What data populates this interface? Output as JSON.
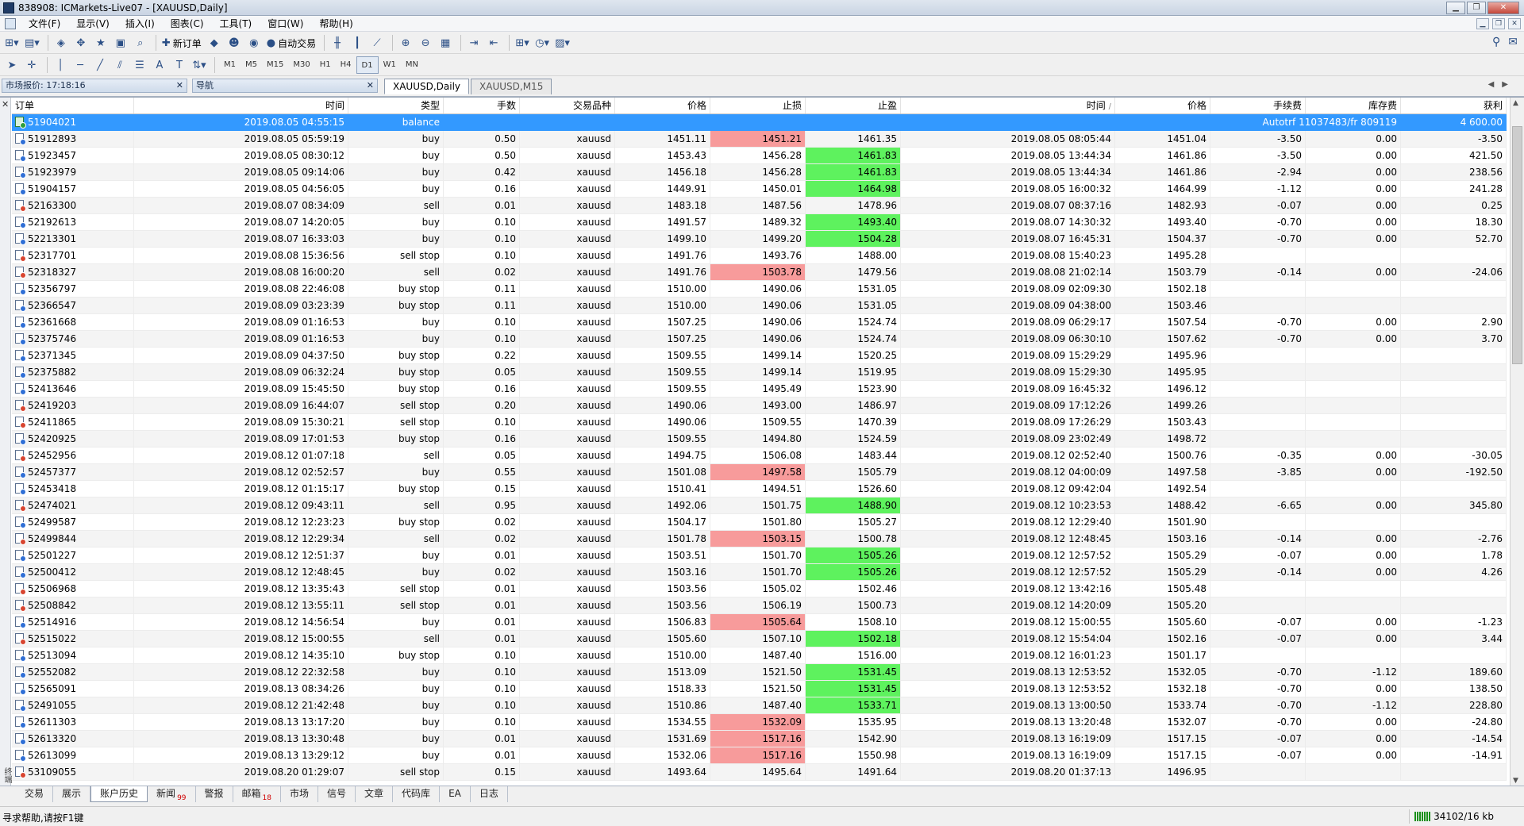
{
  "window": {
    "title": "838908: ICMarkets-Live07 - [XAUUSD,Daily]"
  },
  "menu": [
    "文件(F)",
    "显示(V)",
    "插入(I)",
    "图表(C)",
    "工具(T)",
    "窗口(W)",
    "帮助(H)"
  ],
  "toolbar": {
    "new_order_label": "新订单",
    "auto_trade_label": "自动交易"
  },
  "timeframes": [
    "M1",
    "M5",
    "M15",
    "M30",
    "H1",
    "H4",
    "D1",
    "W1",
    "MN"
  ],
  "active_timeframe": "D1",
  "panels": {
    "market_watch": "市场报价: 17:18:16",
    "navigator": "导航"
  },
  "chart_tabs": [
    {
      "label": "XAUUSD,Daily",
      "active": true
    },
    {
      "label": "XAUUSD,M15",
      "active": false
    }
  ],
  "columns": [
    "订单",
    "时间",
    "类型",
    "手数",
    "交易品种",
    "价格",
    "止损",
    "止盈",
    "时间",
    "价格",
    "手续费",
    "库存费",
    "获利"
  ],
  "sort_indicator": "/",
  "rows": [
    {
      "id": "51904021",
      "open": "2019.08.05 04:55:15",
      "type": "balance",
      "comment": "Autotrf 11037483/fr 809119",
      "profit": "4 600.00",
      "selected": true
    },
    {
      "id": "51912893",
      "open": "2019.08.05 05:59:19",
      "type": "buy",
      "lots": "0.50",
      "sym": "xauusd",
      "price": "1451.11",
      "sl": "1451.21",
      "tp": "1461.35",
      "close": "2019.08.05 08:05:44",
      "cprice": "1451.04",
      "comm": "-3.50",
      "swap": "0.00",
      "profit": "-3.50",
      "hit": "sl"
    },
    {
      "id": "51923457",
      "open": "2019.08.05 08:30:12",
      "type": "buy",
      "lots": "0.50",
      "sym": "xauusd",
      "price": "1453.43",
      "sl": "1456.28",
      "tp": "1461.83",
      "close": "2019.08.05 13:44:34",
      "cprice": "1461.86",
      "comm": "-3.50",
      "swap": "0.00",
      "profit": "421.50",
      "hit": "tp"
    },
    {
      "id": "51923979",
      "open": "2019.08.05 09:14:06",
      "type": "buy",
      "lots": "0.42",
      "sym": "xauusd",
      "price": "1456.18",
      "sl": "1456.28",
      "tp": "1461.83",
      "close": "2019.08.05 13:44:34",
      "cprice": "1461.86",
      "comm": "-2.94",
      "swap": "0.00",
      "profit": "238.56",
      "hit": "tp"
    },
    {
      "id": "51904157",
      "open": "2019.08.05 04:56:05",
      "type": "buy",
      "lots": "0.16",
      "sym": "xauusd",
      "price": "1449.91",
      "sl": "1450.01",
      "tp": "1464.98",
      "close": "2019.08.05 16:00:32",
      "cprice": "1464.99",
      "comm": "-1.12",
      "swap": "0.00",
      "profit": "241.28",
      "hit": "tp"
    },
    {
      "id": "52163300",
      "open": "2019.08.07 08:34:09",
      "type": "sell",
      "lots": "0.01",
      "sym": "xauusd",
      "price": "1483.18",
      "sl": "1487.56",
      "tp": "1478.96",
      "close": "2019.08.07 08:37:16",
      "cprice": "1482.93",
      "comm": "-0.07",
      "swap": "0.00",
      "profit": "0.25"
    },
    {
      "id": "52192613",
      "open": "2019.08.07 14:20:05",
      "type": "buy",
      "lots": "0.10",
      "sym": "xauusd",
      "price": "1491.57",
      "sl": "1489.32",
      "tp": "1493.40",
      "close": "2019.08.07 14:30:32",
      "cprice": "1493.40",
      "comm": "-0.70",
      "swap": "0.00",
      "profit": "18.30",
      "hit": "tp"
    },
    {
      "id": "52213301",
      "open": "2019.08.07 16:33:03",
      "type": "buy",
      "lots": "0.10",
      "sym": "xauusd",
      "price": "1499.10",
      "sl": "1499.20",
      "tp": "1504.28",
      "close": "2019.08.07 16:45:31",
      "cprice": "1504.37",
      "comm": "-0.70",
      "swap": "0.00",
      "profit": "52.70",
      "hit": "tp"
    },
    {
      "id": "52317701",
      "open": "2019.08.08 15:36:56",
      "type": "sell stop",
      "lots": "0.10",
      "sym": "xauusd",
      "price": "1491.76",
      "sl": "1493.76",
      "tp": "1488.00",
      "close": "2019.08.08 15:40:23",
      "cprice": "1495.28"
    },
    {
      "id": "52318327",
      "open": "2019.08.08 16:00:20",
      "type": "sell",
      "lots": "0.02",
      "sym": "xauusd",
      "price": "1491.76",
      "sl": "1503.78",
      "tp": "1479.56",
      "close": "2019.08.08 21:02:14",
      "cprice": "1503.79",
      "comm": "-0.14",
      "swap": "0.00",
      "profit": "-24.06",
      "hit": "sl"
    },
    {
      "id": "52356797",
      "open": "2019.08.08 22:46:08",
      "type": "buy stop",
      "lots": "0.11",
      "sym": "xauusd",
      "price": "1510.00",
      "sl": "1490.06",
      "tp": "1531.05",
      "close": "2019.08.09 02:09:30",
      "cprice": "1502.18"
    },
    {
      "id": "52366547",
      "open": "2019.08.09 03:23:39",
      "type": "buy stop",
      "lots": "0.11",
      "sym": "xauusd",
      "price": "1510.00",
      "sl": "1490.06",
      "tp": "1531.05",
      "close": "2019.08.09 04:38:00",
      "cprice": "1503.46"
    },
    {
      "id": "52361668",
      "open": "2019.08.09 01:16:53",
      "type": "buy",
      "lots": "0.10",
      "sym": "xauusd",
      "price": "1507.25",
      "sl": "1490.06",
      "tp": "1524.74",
      "close": "2019.08.09 06:29:17",
      "cprice": "1507.54",
      "comm": "-0.70",
      "swap": "0.00",
      "profit": "2.90"
    },
    {
      "id": "52375746",
      "open": "2019.08.09 01:16:53",
      "type": "buy",
      "lots": "0.10",
      "sym": "xauusd",
      "price": "1507.25",
      "sl": "1490.06",
      "tp": "1524.74",
      "close": "2019.08.09 06:30:10",
      "cprice": "1507.62",
      "comm": "-0.70",
      "swap": "0.00",
      "profit": "3.70"
    },
    {
      "id": "52371345",
      "open": "2019.08.09 04:37:50",
      "type": "buy stop",
      "lots": "0.22",
      "sym": "xauusd",
      "price": "1509.55",
      "sl": "1499.14",
      "tp": "1520.25",
      "close": "2019.08.09 15:29:29",
      "cprice": "1495.96"
    },
    {
      "id": "52375882",
      "open": "2019.08.09 06:32:24",
      "type": "buy stop",
      "lots": "0.05",
      "sym": "xauusd",
      "price": "1509.55",
      "sl": "1499.14",
      "tp": "1519.95",
      "close": "2019.08.09 15:29:30",
      "cprice": "1495.95"
    },
    {
      "id": "52413646",
      "open": "2019.08.09 15:45:50",
      "type": "buy stop",
      "lots": "0.16",
      "sym": "xauusd",
      "price": "1509.55",
      "sl": "1495.49",
      "tp": "1523.90",
      "close": "2019.08.09 16:45:32",
      "cprice": "1496.12"
    },
    {
      "id": "52419203",
      "open": "2019.08.09 16:44:07",
      "type": "sell stop",
      "lots": "0.20",
      "sym": "xauusd",
      "price": "1490.06",
      "sl": "1493.00",
      "tp": "1486.97",
      "close": "2019.08.09 17:12:26",
      "cprice": "1499.26"
    },
    {
      "id": "52411865",
      "open": "2019.08.09 15:30:21",
      "type": "sell stop",
      "lots": "0.10",
      "sym": "xauusd",
      "price": "1490.06",
      "sl": "1509.55",
      "tp": "1470.39",
      "close": "2019.08.09 17:26:29",
      "cprice": "1503.43"
    },
    {
      "id": "52420925",
      "open": "2019.08.09 17:01:53",
      "type": "buy stop",
      "lots": "0.16",
      "sym": "xauusd",
      "price": "1509.55",
      "sl": "1494.80",
      "tp": "1524.59",
      "close": "2019.08.09 23:02:49",
      "cprice": "1498.72"
    },
    {
      "id": "52452956",
      "open": "2019.08.12 01:07:18",
      "type": "sell",
      "lots": "0.05",
      "sym": "xauusd",
      "price": "1494.75",
      "sl": "1506.08",
      "tp": "1483.44",
      "close": "2019.08.12 02:52:40",
      "cprice": "1500.76",
      "comm": "-0.35",
      "swap": "0.00",
      "profit": "-30.05"
    },
    {
      "id": "52457377",
      "open": "2019.08.12 02:52:57",
      "type": "buy",
      "lots": "0.55",
      "sym": "xauusd",
      "price": "1501.08",
      "sl": "1497.58",
      "tp": "1505.79",
      "close": "2019.08.12 04:00:09",
      "cprice": "1497.58",
      "comm": "-3.85",
      "swap": "0.00",
      "profit": "-192.50",
      "hit": "sl"
    },
    {
      "id": "52453418",
      "open": "2019.08.12 01:15:17",
      "type": "buy stop",
      "lots": "0.15",
      "sym": "xauusd",
      "price": "1510.41",
      "sl": "1494.51",
      "tp": "1526.60",
      "close": "2019.08.12 09:42:04",
      "cprice": "1492.54"
    },
    {
      "id": "52474021",
      "open": "2019.08.12 09:43:11",
      "type": "sell",
      "lots": "0.95",
      "sym": "xauusd",
      "price": "1492.06",
      "sl": "1501.75",
      "tp": "1488.90",
      "close": "2019.08.12 10:23:53",
      "cprice": "1488.42",
      "comm": "-6.65",
      "swap": "0.00",
      "profit": "345.80",
      "hit": "tp"
    },
    {
      "id": "52499587",
      "open": "2019.08.12 12:23:23",
      "type": "buy stop",
      "lots": "0.02",
      "sym": "xauusd",
      "price": "1504.17",
      "sl": "1501.80",
      "tp": "1505.27",
      "close": "2019.08.12 12:29:40",
      "cprice": "1501.90"
    },
    {
      "id": "52499844",
      "open": "2019.08.12 12:29:34",
      "type": "sell",
      "lots": "0.02",
      "sym": "xauusd",
      "price": "1501.78",
      "sl": "1503.15",
      "tp": "1500.78",
      "close": "2019.08.12 12:48:45",
      "cprice": "1503.16",
      "comm": "-0.14",
      "swap": "0.00",
      "profit": "-2.76",
      "hit": "sl"
    },
    {
      "id": "52501227",
      "open": "2019.08.12 12:51:37",
      "type": "buy",
      "lots": "0.01",
      "sym": "xauusd",
      "price": "1503.51",
      "sl": "1501.70",
      "tp": "1505.26",
      "close": "2019.08.12 12:57:52",
      "cprice": "1505.29",
      "comm": "-0.07",
      "swap": "0.00",
      "profit": "1.78",
      "hit": "tp"
    },
    {
      "id": "52500412",
      "open": "2019.08.12 12:48:45",
      "type": "buy",
      "lots": "0.02",
      "sym": "xauusd",
      "price": "1503.16",
      "sl": "1501.70",
      "tp": "1505.26",
      "close": "2019.08.12 12:57:52",
      "cprice": "1505.29",
      "comm": "-0.14",
      "swap": "0.00",
      "profit": "4.26",
      "hit": "tp"
    },
    {
      "id": "52506968",
      "open": "2019.08.12 13:35:43",
      "type": "sell stop",
      "lots": "0.01",
      "sym": "xauusd",
      "price": "1503.56",
      "sl": "1505.02",
      "tp": "1502.46",
      "close": "2019.08.12 13:42:16",
      "cprice": "1505.48"
    },
    {
      "id": "52508842",
      "open": "2019.08.12 13:55:11",
      "type": "sell stop",
      "lots": "0.01",
      "sym": "xauusd",
      "price": "1503.56",
      "sl": "1506.19",
      "tp": "1500.73",
      "close": "2019.08.12 14:20:09",
      "cprice": "1505.20"
    },
    {
      "id": "52514916",
      "open": "2019.08.12 14:56:54",
      "type": "buy",
      "lots": "0.01",
      "sym": "xauusd",
      "price": "1506.83",
      "sl": "1505.64",
      "tp": "1508.10",
      "close": "2019.08.12 15:00:55",
      "cprice": "1505.60",
      "comm": "-0.07",
      "swap": "0.00",
      "profit": "-1.23",
      "hit": "sl"
    },
    {
      "id": "52515022",
      "open": "2019.08.12 15:00:55",
      "type": "sell",
      "lots": "0.01",
      "sym": "xauusd",
      "price": "1505.60",
      "sl": "1507.10",
      "tp": "1502.18",
      "close": "2019.08.12 15:54:04",
      "cprice": "1502.16",
      "comm": "-0.07",
      "swap": "0.00",
      "profit": "3.44",
      "hit": "tp"
    },
    {
      "id": "52513094",
      "open": "2019.08.12 14:35:10",
      "type": "buy stop",
      "lots": "0.10",
      "sym": "xauusd",
      "price": "1510.00",
      "sl": "1487.40",
      "tp": "1516.00",
      "close": "2019.08.12 16:01:23",
      "cprice": "1501.17"
    },
    {
      "id": "52552082",
      "open": "2019.08.12 22:32:58",
      "type": "buy",
      "lots": "0.10",
      "sym": "xauusd",
      "price": "1513.09",
      "sl": "1521.50",
      "tp": "1531.45",
      "close": "2019.08.13 12:53:52",
      "cprice": "1532.05",
      "comm": "-0.70",
      "swap": "-1.12",
      "profit": "189.60",
      "hit": "tp"
    },
    {
      "id": "52565091",
      "open": "2019.08.13 08:34:26",
      "type": "buy",
      "lots": "0.10",
      "sym": "xauusd",
      "price": "1518.33",
      "sl": "1521.50",
      "tp": "1531.45",
      "close": "2019.08.13 12:53:52",
      "cprice": "1532.18",
      "comm": "-0.70",
      "swap": "0.00",
      "profit": "138.50",
      "hit": "tp"
    },
    {
      "id": "52491055",
      "open": "2019.08.12 21:42:48",
      "type": "buy",
      "lots": "0.10",
      "sym": "xauusd",
      "price": "1510.86",
      "sl": "1487.40",
      "tp": "1533.71",
      "close": "2019.08.13 13:00:50",
      "cprice": "1533.74",
      "comm": "-0.70",
      "swap": "-1.12",
      "profit": "228.80",
      "hit": "tp"
    },
    {
      "id": "52611303",
      "open": "2019.08.13 13:17:20",
      "type": "buy",
      "lots": "0.10",
      "sym": "xauusd",
      "price": "1534.55",
      "sl": "1532.09",
      "tp": "1535.95",
      "close": "2019.08.13 13:20:48",
      "cprice": "1532.07",
      "comm": "-0.70",
      "swap": "0.00",
      "profit": "-24.80",
      "hit": "sl"
    },
    {
      "id": "52613320",
      "open": "2019.08.13 13:30:48",
      "type": "buy",
      "lots": "0.01",
      "sym": "xauusd",
      "price": "1531.69",
      "sl": "1517.16",
      "tp": "1542.90",
      "close": "2019.08.13 16:19:09",
      "cprice": "1517.15",
      "comm": "-0.07",
      "swap": "0.00",
      "profit": "-14.54",
      "hit": "sl"
    },
    {
      "id": "52613099",
      "open": "2019.08.13 13:29:12",
      "type": "buy",
      "lots": "0.01",
      "sym": "xauusd",
      "price": "1532.06",
      "sl": "1517.16",
      "tp": "1550.98",
      "close": "2019.08.13 16:19:09",
      "cprice": "1517.15",
      "comm": "-0.07",
      "swap": "0.00",
      "profit": "-14.91",
      "hit": "sl"
    },
    {
      "id": "53109055",
      "open": "2019.08.20 01:29:07",
      "type": "sell stop",
      "lots": "0.15",
      "sym": "xauusd",
      "price": "1493.64",
      "sl": "1495.64",
      "tp": "1491.64",
      "close": "2019.08.20 01:37:13",
      "cprice": "1496.95"
    }
  ],
  "terminal_side_title": "终端",
  "bottom_tabs": [
    {
      "label": "交易"
    },
    {
      "label": "展示"
    },
    {
      "label": "账户历史",
      "active": true
    },
    {
      "label": "新闻",
      "badge": "99"
    },
    {
      "label": "警报"
    },
    {
      "label": "邮箱",
      "badge": "18"
    },
    {
      "label": "市场"
    },
    {
      "label": "信号"
    },
    {
      "label": "文章"
    },
    {
      "label": "代码库"
    },
    {
      "label": "EA"
    },
    {
      "label": "日志"
    }
  ],
  "status": {
    "help": "寻求帮助,请按F1键",
    "traffic": "34102/16 kb"
  },
  "colors": {
    "selected_row": "#3399ff",
    "stop_loss_hit": "#f79b9b",
    "take_profit_hit": "#5ef25e"
  }
}
